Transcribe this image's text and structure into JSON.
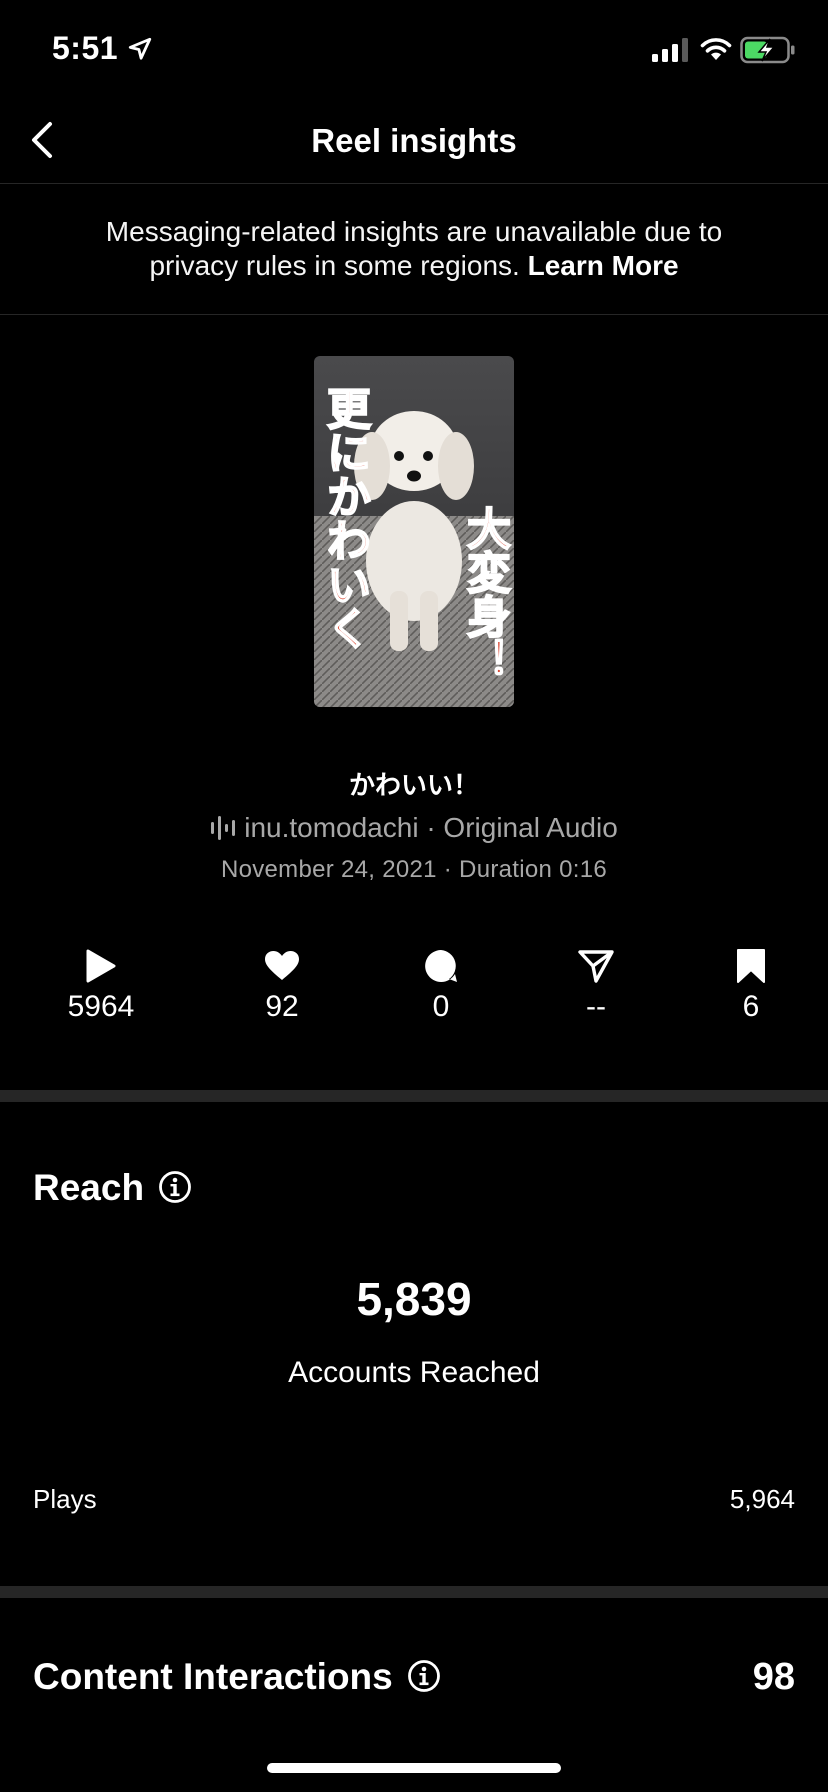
{
  "status": {
    "time": "5:51"
  },
  "header": {
    "title": "Reel insights"
  },
  "notice": {
    "text_line1": "Messaging-related insights are unavailable due to",
    "text_line2": "privacy rules in some regions.",
    "link": "Learn More"
  },
  "reel": {
    "caption_text_left": "更にかわいく",
    "caption_text_right": "大変身！",
    "title": "かわいい！",
    "audio": "inu.tomodachi · Original Audio",
    "meta": "November 24, 2021 · Duration 0:16"
  },
  "stats": {
    "plays": "5964",
    "likes": "92",
    "comments": "0",
    "shares": "--",
    "saves": "6"
  },
  "reach": {
    "title": "Reach",
    "number": "5,839",
    "label": "Accounts Reached",
    "rows": [
      {
        "label": "Plays",
        "value": "5,964"
      }
    ]
  },
  "content_interactions": {
    "title": "Content Interactions",
    "value": "98"
  },
  "colors": {
    "background": "#000000",
    "divider": "#262626",
    "secondary_text": "#a8a8a8",
    "caption_red": "#d8432f",
    "battery_green": "#4cd964"
  }
}
